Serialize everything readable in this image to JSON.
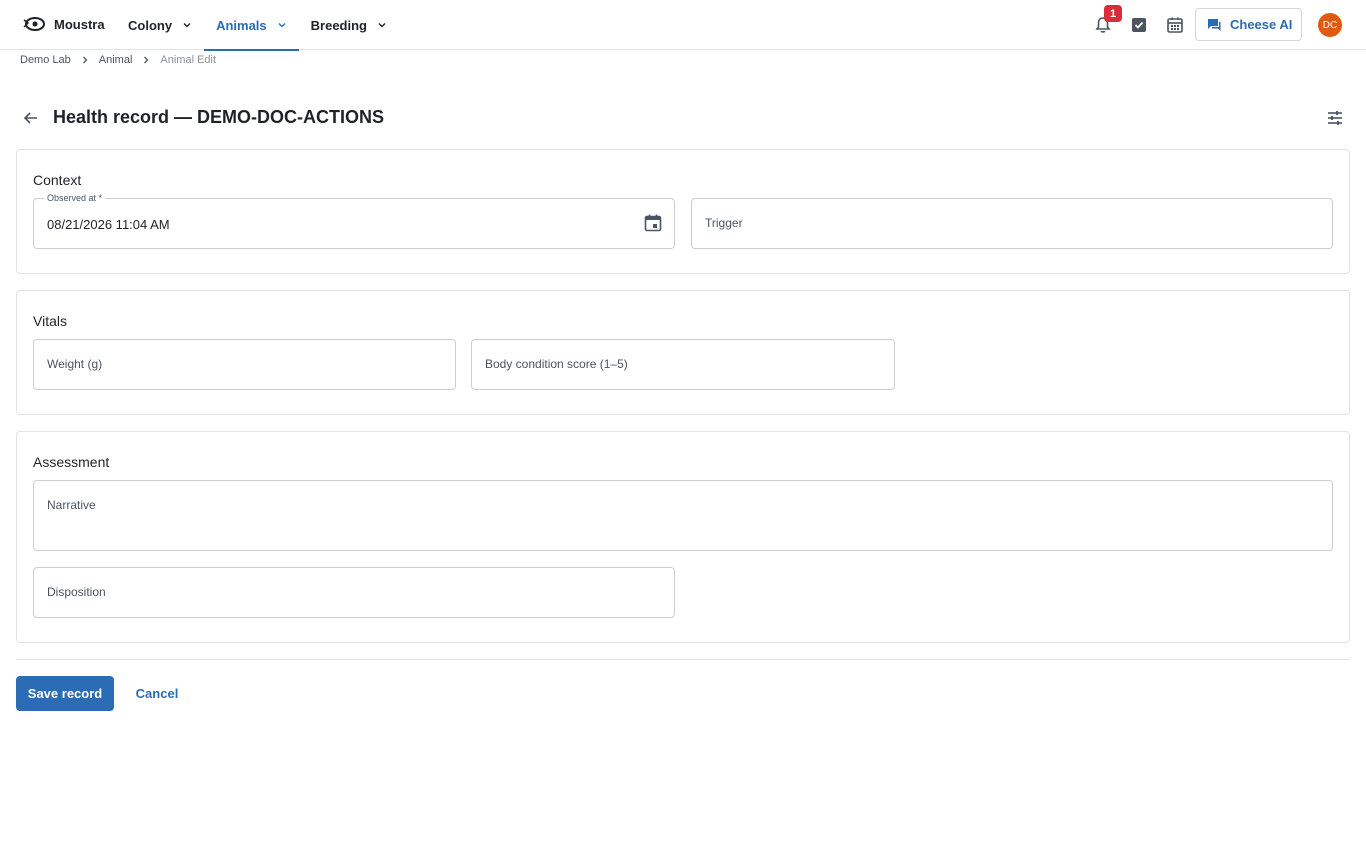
{
  "app": {
    "name": "Moustra",
    "logo_icon": "moustra-logo-icon"
  },
  "nav": {
    "items": [
      {
        "label": "Colony",
        "active": false
      },
      {
        "label": "Animals",
        "active": true
      },
      {
        "label": "Breeding",
        "active": false
      }
    ]
  },
  "header": {
    "notifications_count": "1",
    "ai_button_label": "Cheese AI",
    "avatar_initials": "DC"
  },
  "breadcrumb": [
    "Demo Lab",
    "Animal",
    "Animal Edit"
  ],
  "page": {
    "title": "Health record — DEMO-DOC-ACTIONS"
  },
  "context": {
    "title": "Context",
    "observed_at_label": "Observed at *",
    "observed_at_value": "08/21/2026 11:04 AM",
    "trigger_placeholder": "Trigger"
  },
  "vitals": {
    "title": "Vitals",
    "weight_placeholder": "Weight (g)",
    "bcs_placeholder": "Body condition score (1–5)"
  },
  "assessment": {
    "title": "Assessment",
    "narrative_placeholder": "Narrative",
    "disposition_placeholder": "Disposition"
  },
  "actions": {
    "save_label": "Save record",
    "cancel_label": "Cancel"
  },
  "colors": {
    "accent": "#2a6db5",
    "badge": "#d92d3a",
    "avatar": "#e05a12",
    "border": "#dfe3e8"
  }
}
